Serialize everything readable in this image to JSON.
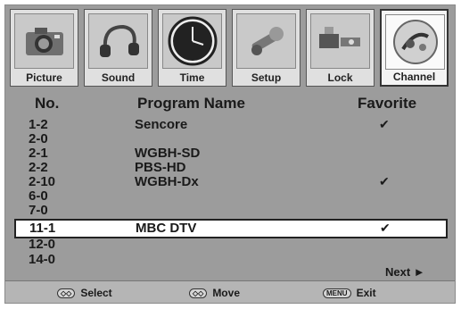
{
  "tabs": [
    {
      "label": "Picture",
      "icon": "camera-icon",
      "active": false
    },
    {
      "label": "Sound",
      "icon": "headphones-icon",
      "active": false
    },
    {
      "label": "Time",
      "icon": "clock-icon",
      "active": false
    },
    {
      "label": "Setup",
      "icon": "wrench-icon",
      "active": false
    },
    {
      "label": "Lock",
      "icon": "lock-icon",
      "active": false
    },
    {
      "label": "Channel",
      "icon": "satellite-dish-icon",
      "active": true
    }
  ],
  "table": {
    "headers": {
      "no": "No.",
      "name": "Program Name",
      "fav": "Favorite"
    },
    "rows": [
      {
        "no": "1-2",
        "name": "Sencore",
        "fav": true
      },
      {
        "no": "2-0",
        "name": "",
        "fav": false
      },
      {
        "no": "2-1",
        "name": "WGBH-SD",
        "fav": false
      },
      {
        "no": "2-2",
        "name": "PBS-HD",
        "fav": false
      },
      {
        "no": "2-10",
        "name": "WGBH-Dx",
        "fav": true
      },
      {
        "no": "6-0",
        "name": "",
        "fav": false
      },
      {
        "no": "7-0",
        "name": "",
        "fav": false
      },
      {
        "no": "11-1",
        "name": "MBC DTV",
        "fav": true,
        "selected": true
      },
      {
        "no": "12-0",
        "name": "",
        "fav": false
      },
      {
        "no": "14-0",
        "name": "",
        "fav": false
      }
    ],
    "check_glyph": "✔"
  },
  "next_label": "Next ►",
  "footer": {
    "select_keys": "◇◇",
    "select": "Select",
    "move_keys": "◇◇",
    "move": "Move",
    "menu_key": "MENU",
    "exit": "Exit"
  }
}
